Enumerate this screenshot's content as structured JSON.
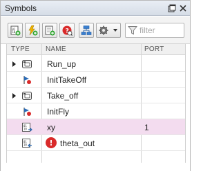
{
  "window": {
    "title": "Symbols"
  },
  "filter": {
    "placeholder": "filter"
  },
  "table": {
    "headers": {
      "type": "TYPE",
      "name": "NAME",
      "port": "PORT"
    },
    "rows": [
      {
        "name": "Run_up",
        "port": "",
        "type_icon": "state-icon",
        "expandable": true
      },
      {
        "name": "InitTakeOff",
        "port": "",
        "type_icon": "event-icon",
        "expandable": false
      },
      {
        "name": "Take_off",
        "port": "",
        "type_icon": "state-icon",
        "expandable": true
      },
      {
        "name": "InitFly",
        "port": "",
        "type_icon": "event-icon",
        "expandable": false
      },
      {
        "name": "xy",
        "port": "1",
        "type_icon": "data-input-icon",
        "expandable": false,
        "selected": true
      },
      {
        "name": "theta_out",
        "port": "",
        "type_icon": "data-output-icon",
        "expandable": false,
        "error": true
      }
    ]
  },
  "colors": {
    "selection": "#f3dcef",
    "error": "#d92a2a",
    "accent": "#2a6ab5"
  }
}
